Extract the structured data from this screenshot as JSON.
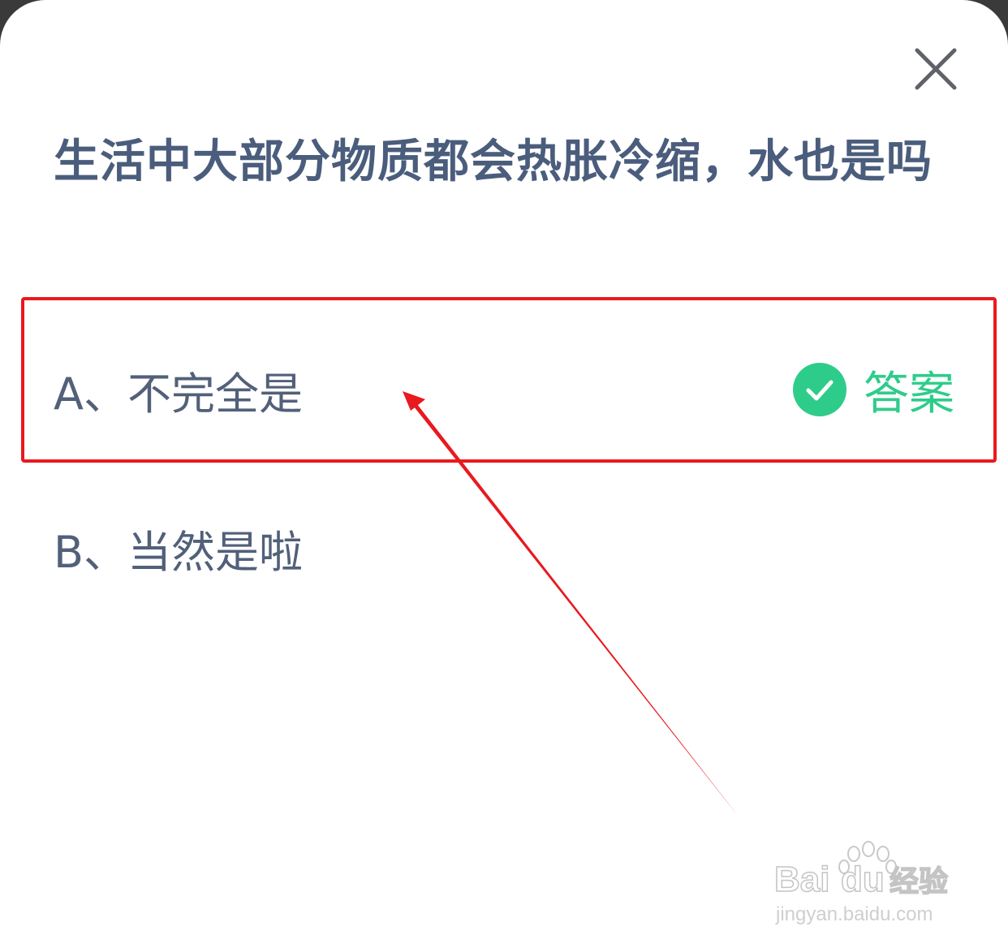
{
  "dialog": {
    "question": "生活中大部分物质都会热胀冷缩，水也是吗",
    "options": [
      {
        "label": "A、不完全是",
        "is_answer": true
      },
      {
        "label": "B、当然是啦",
        "is_answer": false
      }
    ],
    "answer_label": "答案"
  },
  "colors": {
    "question_text": "#4b5d7c",
    "option_text": "#52607a",
    "answer_green": "#2ecc8a",
    "annotation_red": "#e8191f"
  },
  "icons": {
    "close": "close-icon",
    "check": "check-circle-icon"
  },
  "watermark": {
    "brand": "Bai",
    "brand_tail": "du",
    "product": "经验",
    "url": "jingyan.baidu.com"
  }
}
